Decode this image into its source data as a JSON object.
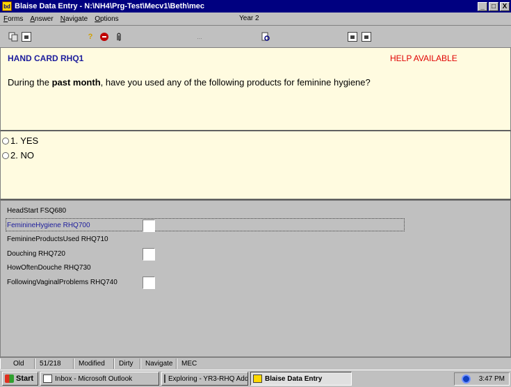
{
  "window": {
    "title": "Blaise Data Entry - N:\\NH4\\Prg-Test\\Mecv1\\Beth\\mec",
    "app_icon_label": "bd",
    "buttons": [
      "_",
      "□",
      "X"
    ]
  },
  "menu": {
    "items": [
      "Forms",
      "Answer",
      "Navigate",
      "Options"
    ],
    "year_label": "Year 2"
  },
  "toolbar": {
    "help_glyph": "?",
    "dots": "..."
  },
  "question": {
    "hand_card": "HAND CARD RHQ1",
    "help_available": "HELP AVAILABLE",
    "text_before": "During the ",
    "text_bold": "past month",
    "text_after": ", have you used any of the following products for feminine hygiene?"
  },
  "answers": [
    {
      "label": "1. YES",
      "selected": false
    },
    {
      "label": "2. NO",
      "selected": false
    }
  ],
  "fields": [
    {
      "label": "HeadStart FSQ680",
      "has_box": false,
      "active": false
    },
    {
      "label": "FeminineHygiene RHQ700",
      "has_box": true,
      "active": true
    },
    {
      "label": "FeminineProductsUsed RHQ710",
      "has_box": false,
      "active": false
    },
    {
      "label": "Douching RHQ720",
      "has_box": true,
      "active": false
    },
    {
      "label": "HowOftenDouche RHQ730",
      "has_box": false,
      "active": false
    },
    {
      "label": "FollowingVaginalProblems RHQ740",
      "has_box": true,
      "active": false
    }
  ],
  "status": {
    "mode": "Old",
    "counter": "51/218",
    "modified": "Modified",
    "dirty": "Dirty",
    "navigate": "Navigate",
    "section": "MEC"
  },
  "taskbar": {
    "start": "Start",
    "tasks": [
      "Inbox - Microsoft Outlook",
      "Exploring - YR3-RHQ Add...",
      "Blaise Data Entry"
    ],
    "clock": "3:47 PM"
  },
  "colors": {
    "title_bg": "#000080",
    "pane_bg": "#fffbe0",
    "hand_card": "#1c1c9c",
    "help": "#e00000"
  }
}
